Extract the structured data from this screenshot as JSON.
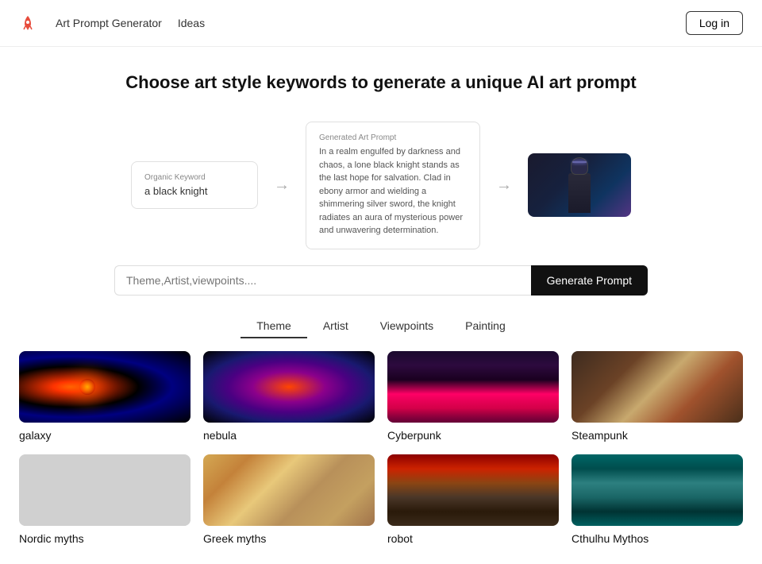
{
  "nav": {
    "logo_alt": "rocket-logo",
    "links": [
      {
        "label": "Art Prompt Generator",
        "id": "art-prompt-generator"
      },
      {
        "label": "Ideas",
        "id": "ideas"
      }
    ],
    "login_label": "Log in"
  },
  "hero": {
    "title": "Choose art style keywords to generate a unique AI art prompt"
  },
  "demo": {
    "organic_label": "Organic Keyword",
    "organic_value": "a black knight",
    "generated_label": "Generated Art Prompt",
    "generated_value": "In a realm engulfed by darkness and chaos, a lone black knight stands as the last hope for salvation. Clad in ebony armor and wielding a shimmering silver sword, the knight radiates an aura of mysterious power and unwavering determination."
  },
  "search": {
    "placeholder": "Theme,Artist,viewpoints....",
    "generate_label": "Generate Prompt"
  },
  "tabs": [
    {
      "label": "Theme",
      "active": true
    },
    {
      "label": "Artist",
      "active": false
    },
    {
      "label": "Viewpoints",
      "active": false
    },
    {
      "label": "Painting",
      "active": false
    }
  ],
  "grid_items": [
    {
      "label": "galaxy",
      "img_class": "img-galaxy"
    },
    {
      "label": "nebula",
      "img_class": "img-nebula"
    },
    {
      "label": "Cyberpunk",
      "img_class": "img-cyberpunk"
    },
    {
      "label": "Steampunk",
      "img_class": "img-steampunk"
    },
    {
      "label": "Nordic myths",
      "img_class": "img-nordic"
    },
    {
      "label": "Greek myths",
      "img_class": "img-greek"
    },
    {
      "label": "robot",
      "img_class": "img-robot"
    },
    {
      "label": "Cthulhu Mythos",
      "img_class": "img-cthulhu"
    }
  ]
}
